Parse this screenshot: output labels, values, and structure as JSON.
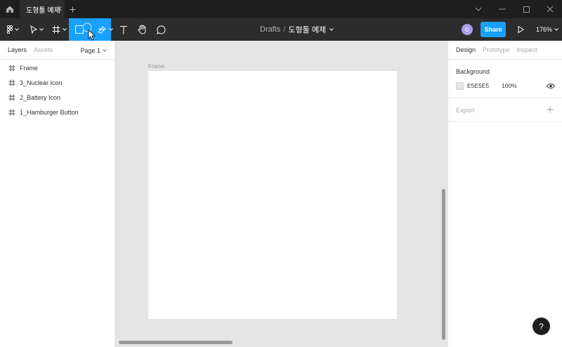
{
  "tabs": {
    "file_tab_label": "도형툴 예제"
  },
  "title": {
    "crumb": "Drafts",
    "separator": "/",
    "file_name": "도형툴 예제"
  },
  "toolbar": {
    "avatar_initial": "G",
    "share_label": "Share",
    "zoom_label": "176%"
  },
  "left_panel": {
    "tab_layers": "Layers",
    "tab_assets": "Assets",
    "page_label": "Page 1",
    "layers": [
      {
        "name": "Frame"
      },
      {
        "name": "3_Nuclear Icon"
      },
      {
        "name": "2_Battery Icon"
      },
      {
        "name": "1_Hamburger Button"
      }
    ]
  },
  "canvas": {
    "frame_label": "Frame"
  },
  "right_panel": {
    "tab_design": "Design",
    "tab_prototype": "Prototype",
    "tab_inspect": "Inspect",
    "background_title": "Background",
    "background_hex": "E5E5E5",
    "background_opacity": "100%",
    "export_title": "Export"
  },
  "help_label": "?",
  "colors": {
    "accent": "#18a0fb",
    "toolbar_bg": "#2c2c2c",
    "tabbar_bg": "#1e1e1e",
    "canvas_bg": "#e5e5e5"
  }
}
